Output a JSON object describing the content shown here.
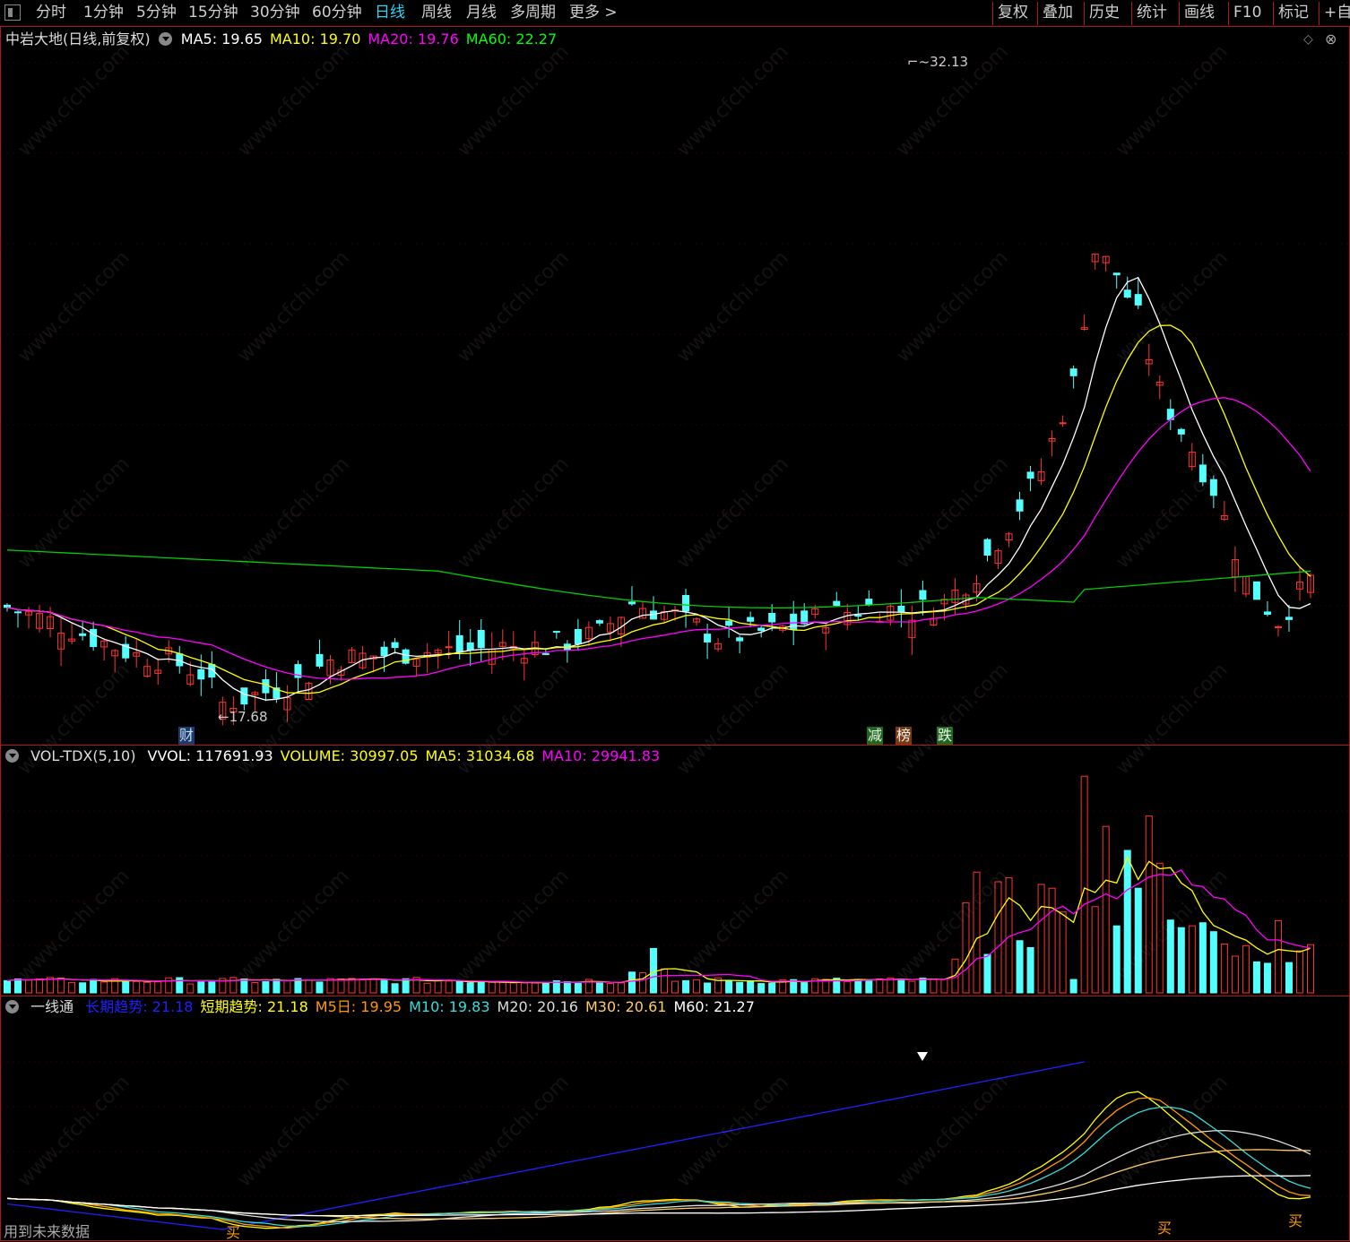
{
  "toolbar": {
    "left_items": [
      "分时",
      "1分钟",
      "5分钟",
      "15分钟",
      "30分钟",
      "60分钟",
      "日线",
      "周线",
      "月线",
      "多周期",
      "更多 >"
    ],
    "active": "日线",
    "right_items": [
      "复权",
      "叠加",
      "历史",
      "统计",
      "画线",
      "F10",
      "标记",
      "+自选"
    ]
  },
  "price_panel": {
    "title": "中岩大地(日线,前复权)",
    "indicators": [
      {
        "label": "MA5: 19.65",
        "color": "#ffffff"
      },
      {
        "label": "MA10: 19.70",
        "color": "#ffff00"
      },
      {
        "label": "MA20: 19.76",
        "color": "#ff00ff"
      },
      {
        "label": "MA60: 22.27",
        "color": "#00ff00"
      }
    ],
    "high_label": "32.13",
    "low_label": "17.68",
    "badges": {
      "cai": "财",
      "jian": "减",
      "bang": "榜",
      "die": "跌"
    }
  },
  "volume_panel": {
    "title": "VOL-TDX(5,10)",
    "indicators": [
      {
        "label": "VVOL: 117691.93",
        "color": "#ffffff"
      },
      {
        "label": "VOLUME: 30997.05",
        "color": "#ffff00"
      },
      {
        "label": "MA5: 31034.68",
        "color": "#ffff00"
      },
      {
        "label": "MA10: 29941.83",
        "color": "#ff00ff"
      }
    ]
  },
  "indicator_panel": {
    "title": "一线通",
    "indicators": [
      {
        "label": "长期趋势: 21.18",
        "color": "#2020ff"
      },
      {
        "label": "短期趋势: 21.18",
        "color": "#ffff00"
      },
      {
        "label": "M5日: 19.95",
        "color": "#ff9900"
      },
      {
        "label": "M10: 19.83",
        "color": "#33dddd"
      },
      {
        "label": "M20: 20.16",
        "color": "#dddddd"
      },
      {
        "label": "M30: 20.61",
        "color": "#ffcc66"
      },
      {
        "label": "M60: 21.27",
        "color": "#ffffff"
      }
    ],
    "buy_label": "买"
  },
  "footer": {
    "note": "用到未来数据"
  },
  "watermark": "www.cfchi.com",
  "colors": {
    "up": "#ff3333",
    "down": "#54ffff",
    "border": "#b01818",
    "ma5": "#ffffff",
    "ma10": "#ffff00",
    "ma20": "#ff00ff",
    "ma60": "#00cc00"
  }
}
